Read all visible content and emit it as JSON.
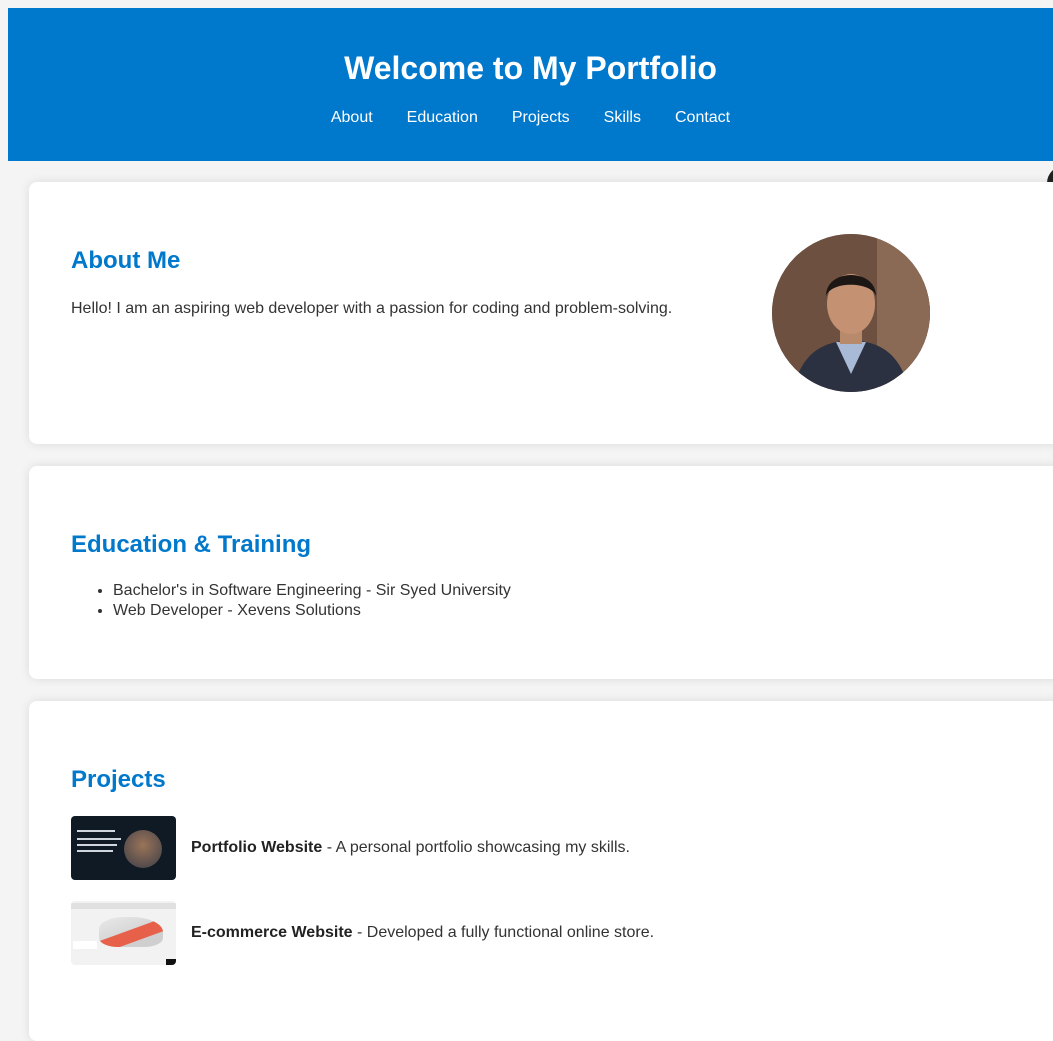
{
  "header": {
    "title": "Welcome to My Portfolio",
    "nav": [
      "About",
      "Education",
      "Projects",
      "Skills",
      "Contact"
    ]
  },
  "about": {
    "heading": "About Me",
    "text": "Hello! I am an aspiring web developer with a passion for coding and problem-solving."
  },
  "education": {
    "heading": "Education & Training",
    "items": [
      "Bachelor's in Software Engineering - Sir Syed University",
      "Web Developer - Xevens Solutions"
    ]
  },
  "projects": {
    "heading": "Projects",
    "items": [
      {
        "title": "Portfolio Website",
        "desc": " - A personal portfolio showcasing my skills."
      },
      {
        "title": "E-commerce Website",
        "desc": " - Developed a fully functional online store."
      }
    ]
  },
  "colors": {
    "accent": "#0078cc",
    "background": "#f4f4f4",
    "card": "#ffffff"
  }
}
